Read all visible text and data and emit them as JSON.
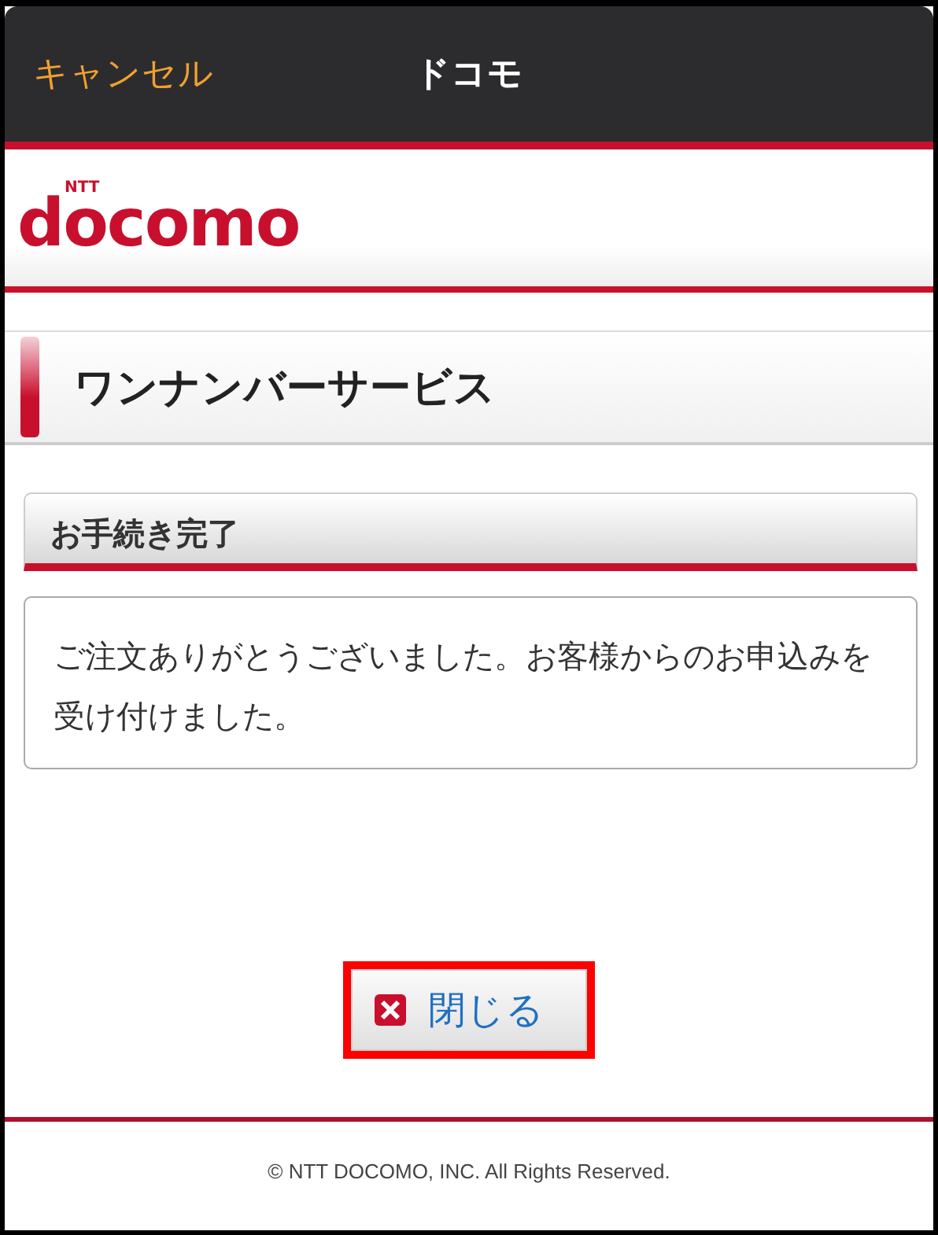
{
  "nav_bar": {
    "cancel": "キャンセル",
    "title": "ドコモ"
  },
  "logo": {
    "small": "NTT",
    "main": "docomo"
  },
  "page_heading": "ワンナンバーサービス",
  "section": {
    "heading": "お手続き完了",
    "message": "ご注文ありがとうございました。お客様からのお申込みを受け付けました。"
  },
  "close_button": {
    "label": "閉じる",
    "highlighted": true
  },
  "footer": "© NTT DOCOMO, INC. All Rights Reserved."
}
